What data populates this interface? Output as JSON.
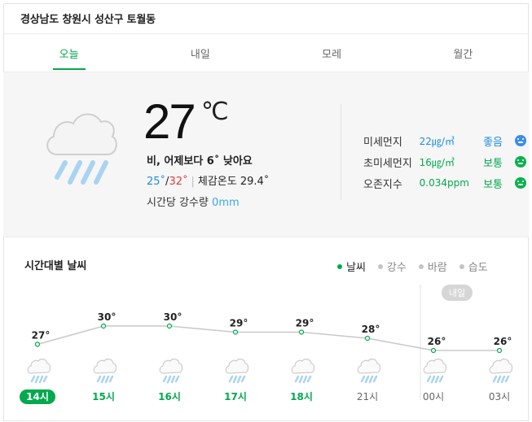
{
  "location": "경상남도 창원시 성산구 토월동",
  "tabs": [
    {
      "label": "오늘",
      "active": true
    },
    {
      "label": "내일",
      "active": false
    },
    {
      "label": "모레",
      "active": false
    },
    {
      "label": "월간",
      "active": false
    }
  ],
  "current": {
    "icon": "rain-cloud-icon",
    "temp": "27",
    "unit": "℃",
    "condition": "비, 어제보다 6˚ 낮아요",
    "low": "25˚",
    "slash": "/",
    "high": "32˚",
    "sep": "|",
    "feels_like": "체감온도 29.4˚",
    "precip_label": "시간당 강수량",
    "precip_value": "0mm"
  },
  "air": [
    {
      "label": "미세먼지",
      "value": "22㎍/㎥",
      "status": "좋음",
      "color": "#1e8ce0",
      "face": "good-face-icon"
    },
    {
      "label": "초미세먼지",
      "value": "16㎍/㎥",
      "status": "보통",
      "color": "#03a94f",
      "face": "normal-face-icon"
    },
    {
      "label": "오존지수",
      "value": "0.034ppm",
      "status": "보통",
      "color": "#03a94f",
      "face": "normal-face-icon"
    }
  ],
  "hourly": {
    "title": "시간대별 날씨",
    "legend": [
      {
        "label": "날씨",
        "active": true
      },
      {
        "label": "강수",
        "active": false
      },
      {
        "label": "바람",
        "active": false
      },
      {
        "label": "습도",
        "active": false
      }
    ],
    "tomorrow_badge": "내일"
  },
  "chart_data": {
    "type": "line",
    "x": [
      "14시",
      "15시",
      "16시",
      "17시",
      "18시",
      "21시",
      "00시",
      "03시"
    ],
    "values": [
      27,
      30,
      30,
      29,
      29,
      28,
      26,
      26
    ],
    "labels": [
      "27°",
      "30°",
      "30°",
      "29°",
      "29°",
      "28°",
      "26°",
      "26°"
    ],
    "current_index": 0,
    "highlight_count": 5,
    "icons": [
      "rain-icon",
      "rain-icon",
      "rain-icon",
      "rain-icon",
      "rain-icon",
      "rain-icon",
      "rain-icon",
      "rain-icon"
    ],
    "colors": {
      "line": "#c8c8c8",
      "point": "#03a94f",
      "highlight": "#03a94f",
      "muted": "#666666"
    }
  }
}
